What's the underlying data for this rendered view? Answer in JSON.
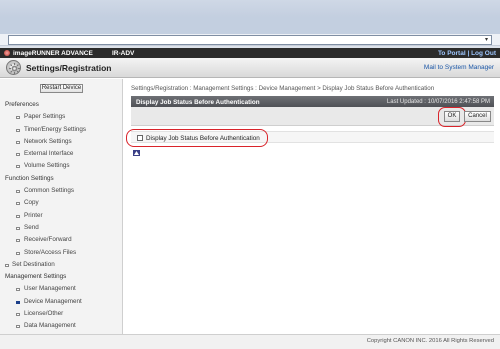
{
  "browser": {
    "address_value": "",
    "dropdown_glyph": "▾"
  },
  "header": {
    "brand": "imageRUNNER ADVANCE",
    "model": "IR-ADV",
    "portal_link": "To Portal",
    "logout_link": "Log Out",
    "page_title": "Settings/Registration",
    "mail_link": "Mail to System Manager"
  },
  "sidebar": {
    "restart_button": "Restart Device",
    "items": [
      {
        "label": "Preferences",
        "kind": "section"
      },
      {
        "label": "Paper Settings",
        "kind": "sub"
      },
      {
        "label": "Timer/Energy Settings",
        "kind": "sub"
      },
      {
        "label": "Network Settings",
        "kind": "sub"
      },
      {
        "label": "External Interface",
        "kind": "sub"
      },
      {
        "label": "Volume Settings",
        "kind": "sub"
      },
      {
        "label": "Function Settings",
        "kind": "section"
      },
      {
        "label": "Common Settings",
        "kind": "sub"
      },
      {
        "label": "Copy",
        "kind": "sub"
      },
      {
        "label": "Printer",
        "kind": "sub"
      },
      {
        "label": "Send",
        "kind": "sub"
      },
      {
        "label": "Receive/Forward",
        "kind": "sub"
      },
      {
        "label": "Store/Access Files",
        "kind": "sub"
      },
      {
        "label": "Set Destination",
        "kind": "top"
      },
      {
        "label": "Management Settings",
        "kind": "section"
      },
      {
        "label": "User Management",
        "kind": "sub"
      },
      {
        "label": "Device Management",
        "kind": "sub",
        "active": true
      },
      {
        "label": "License/Other",
        "kind": "sub"
      },
      {
        "label": "Data Management",
        "kind": "sub"
      }
    ]
  },
  "main": {
    "breadcrumb": "Settings/Registration : Management Settings : Device Management > Display Job Status Before Authentication",
    "panel_title": "Display Job Status Before Authentication",
    "last_updated": "Last Updated : 10/07/2016 2:47:58 PM",
    "ok_button": "OK",
    "cancel_button": "Cancel",
    "option_label": "Display Job Status Before Authentication",
    "option_checked": false
  },
  "footer": {
    "copyright": "Copyright CANON INC. 2016 All Rights Reserved"
  },
  "colors": {
    "highlight_ring": "#d9242b",
    "panel_header": "#55575c",
    "brand_bar": "#2b2b2b",
    "link": "#1a56a6"
  }
}
